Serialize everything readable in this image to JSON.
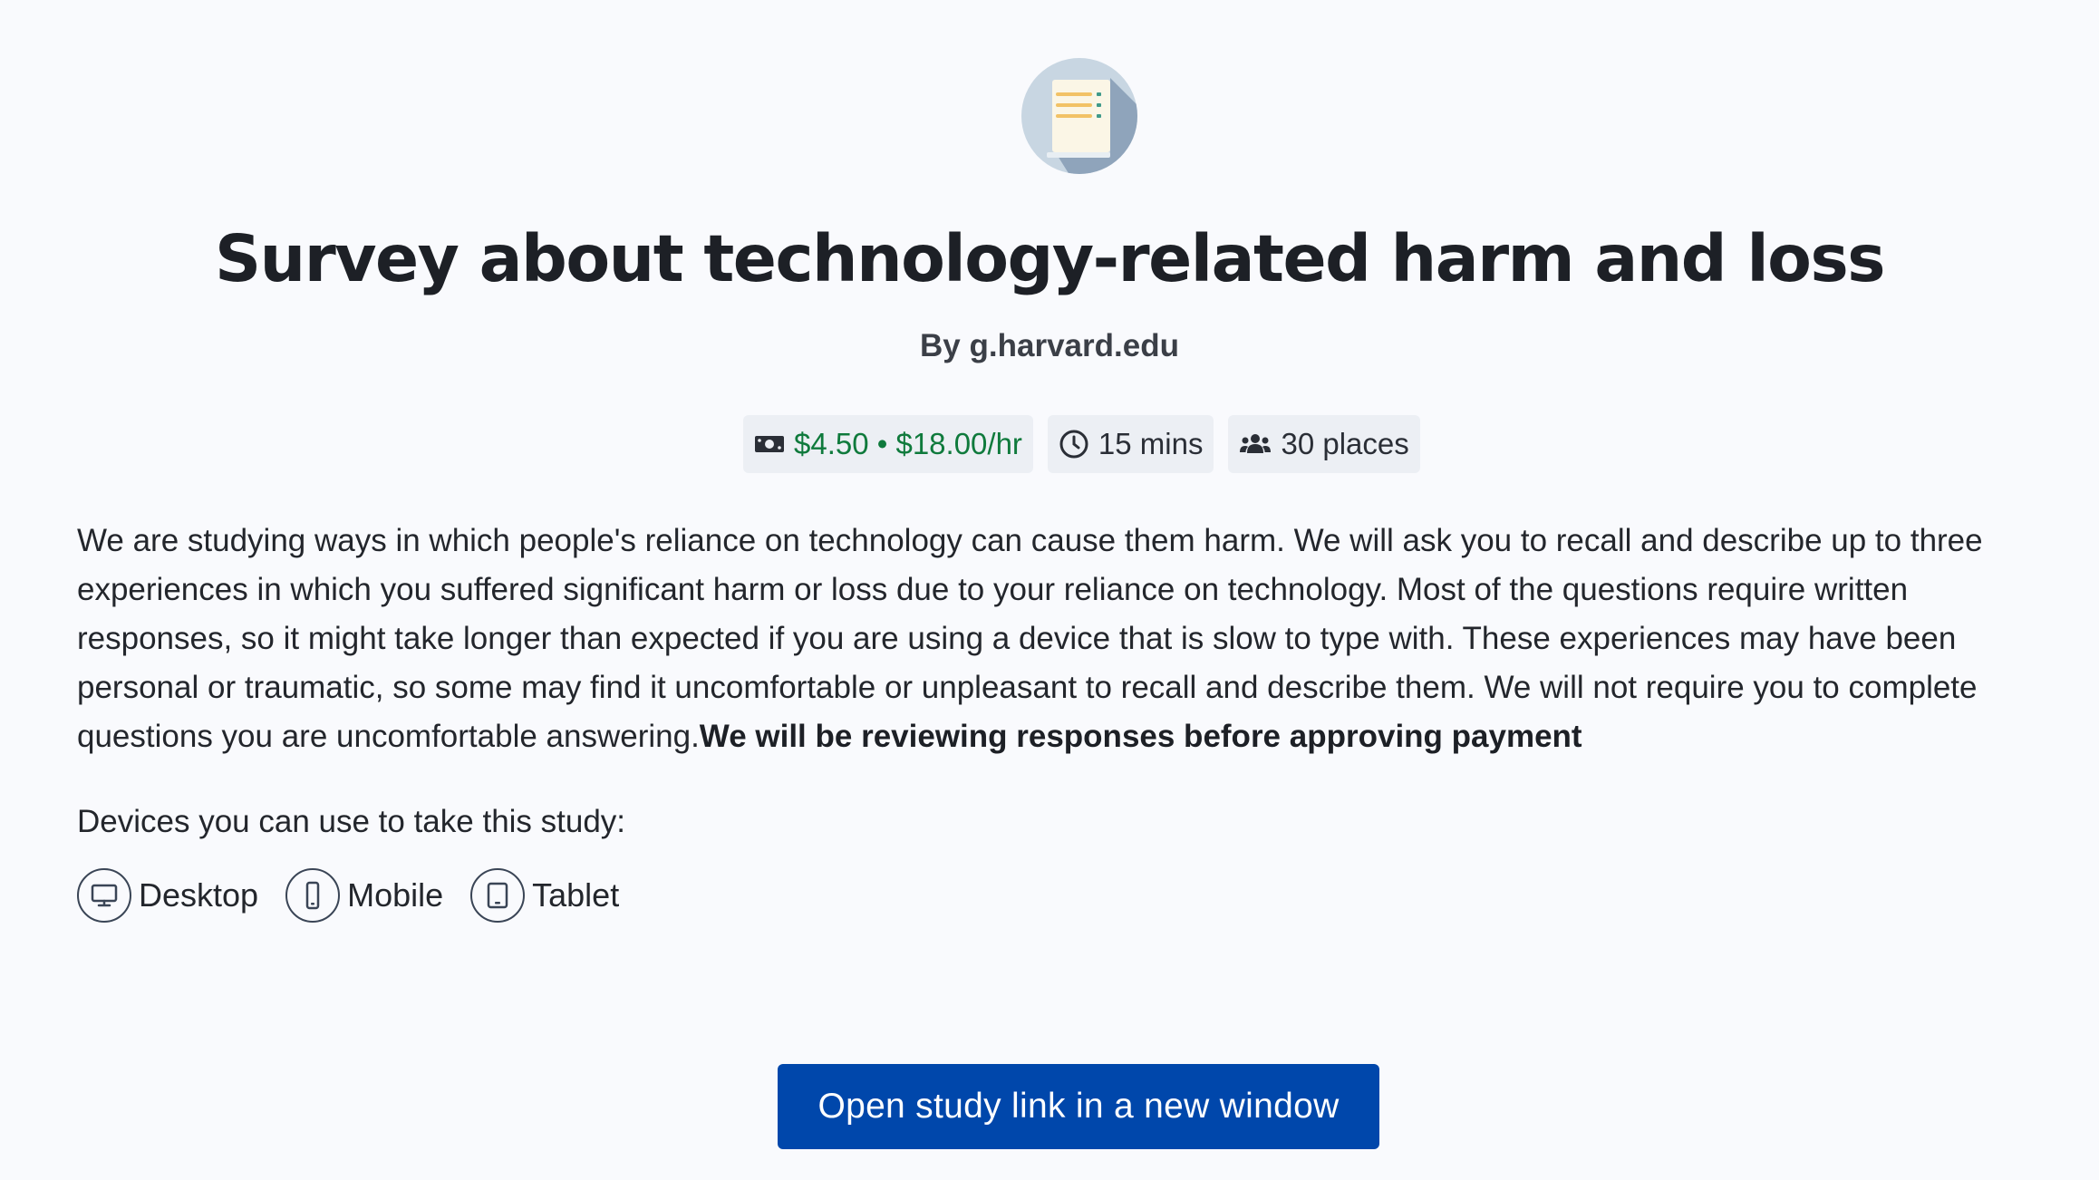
{
  "study": {
    "icon": "survey-document-icon",
    "title": "Survey about technology-related harm and loss",
    "byline_prefix": "By",
    "researcher": "g.harvard.edu"
  },
  "badges": {
    "reward": {
      "icon": "money-bill-icon",
      "label": "$4.50 • $18.00/hr",
      "color": "#0f7a3c"
    },
    "duration": {
      "icon": "clock-icon",
      "label": "15 mins"
    },
    "places": {
      "icon": "users-icon",
      "label": "30 places"
    }
  },
  "description": {
    "text": "We are studying ways in which people's reliance on technology can cause them harm. We will ask you to recall and describe up to three experiences in which you suffered significant harm or loss due to your reliance on technology. Most of the questions require written responses, so it might take longer than expected if you are using a device that is slow to type with.  These experiences may have been personal or traumatic, so some may find it uncomfortable or unpleasant to recall and describe them. We will not require you to complete questions you are uncomfortable answering.",
    "bold_text": "We will be reviewing responses before approving payment"
  },
  "devices": {
    "label": "Devices you can use to take this study:",
    "items": [
      {
        "icon": "desktop-icon",
        "label": "Desktop"
      },
      {
        "icon": "mobile-icon",
        "label": "Mobile"
      },
      {
        "icon": "tablet-icon",
        "label": "Tablet"
      }
    ]
  },
  "actions": {
    "open_study_label": "Open study link in a new window",
    "button_color": "#0047ab"
  }
}
